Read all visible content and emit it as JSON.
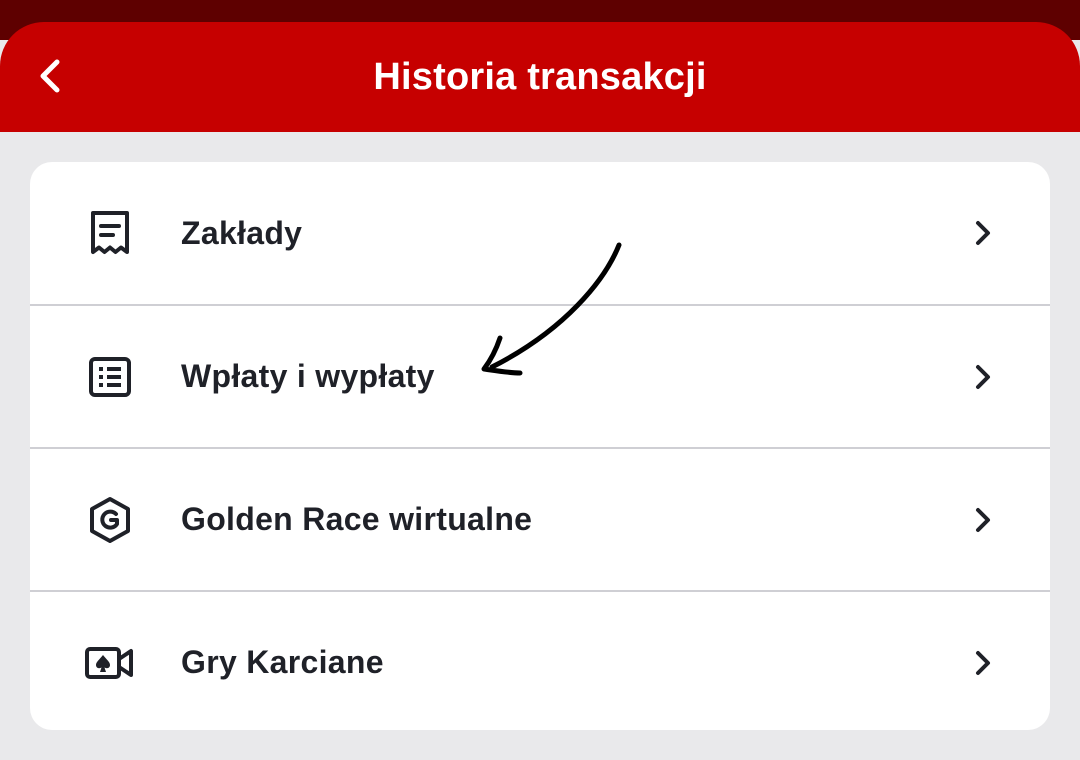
{
  "header": {
    "title": "Historia transakcji",
    "back_icon": "chevron-left-icon",
    "background_color": "#c60000",
    "status_bar_color": "#5e0000"
  },
  "menu": {
    "items": [
      {
        "label": "Zakłady",
        "icon": "receipt-icon"
      },
      {
        "label": "Wpłaty i wypłaty",
        "icon": "list-document-icon"
      },
      {
        "label": "Golden Race wirtualne",
        "icon": "hexagon-g-icon"
      },
      {
        "label": "Gry Karciane",
        "icon": "card-video-camera-icon"
      }
    ],
    "chevron_icon": "chevron-right-icon"
  },
  "annotation": {
    "icon": "hand-drawn-arrow-icon",
    "points_to": "Wpłaty i wypłaty"
  }
}
